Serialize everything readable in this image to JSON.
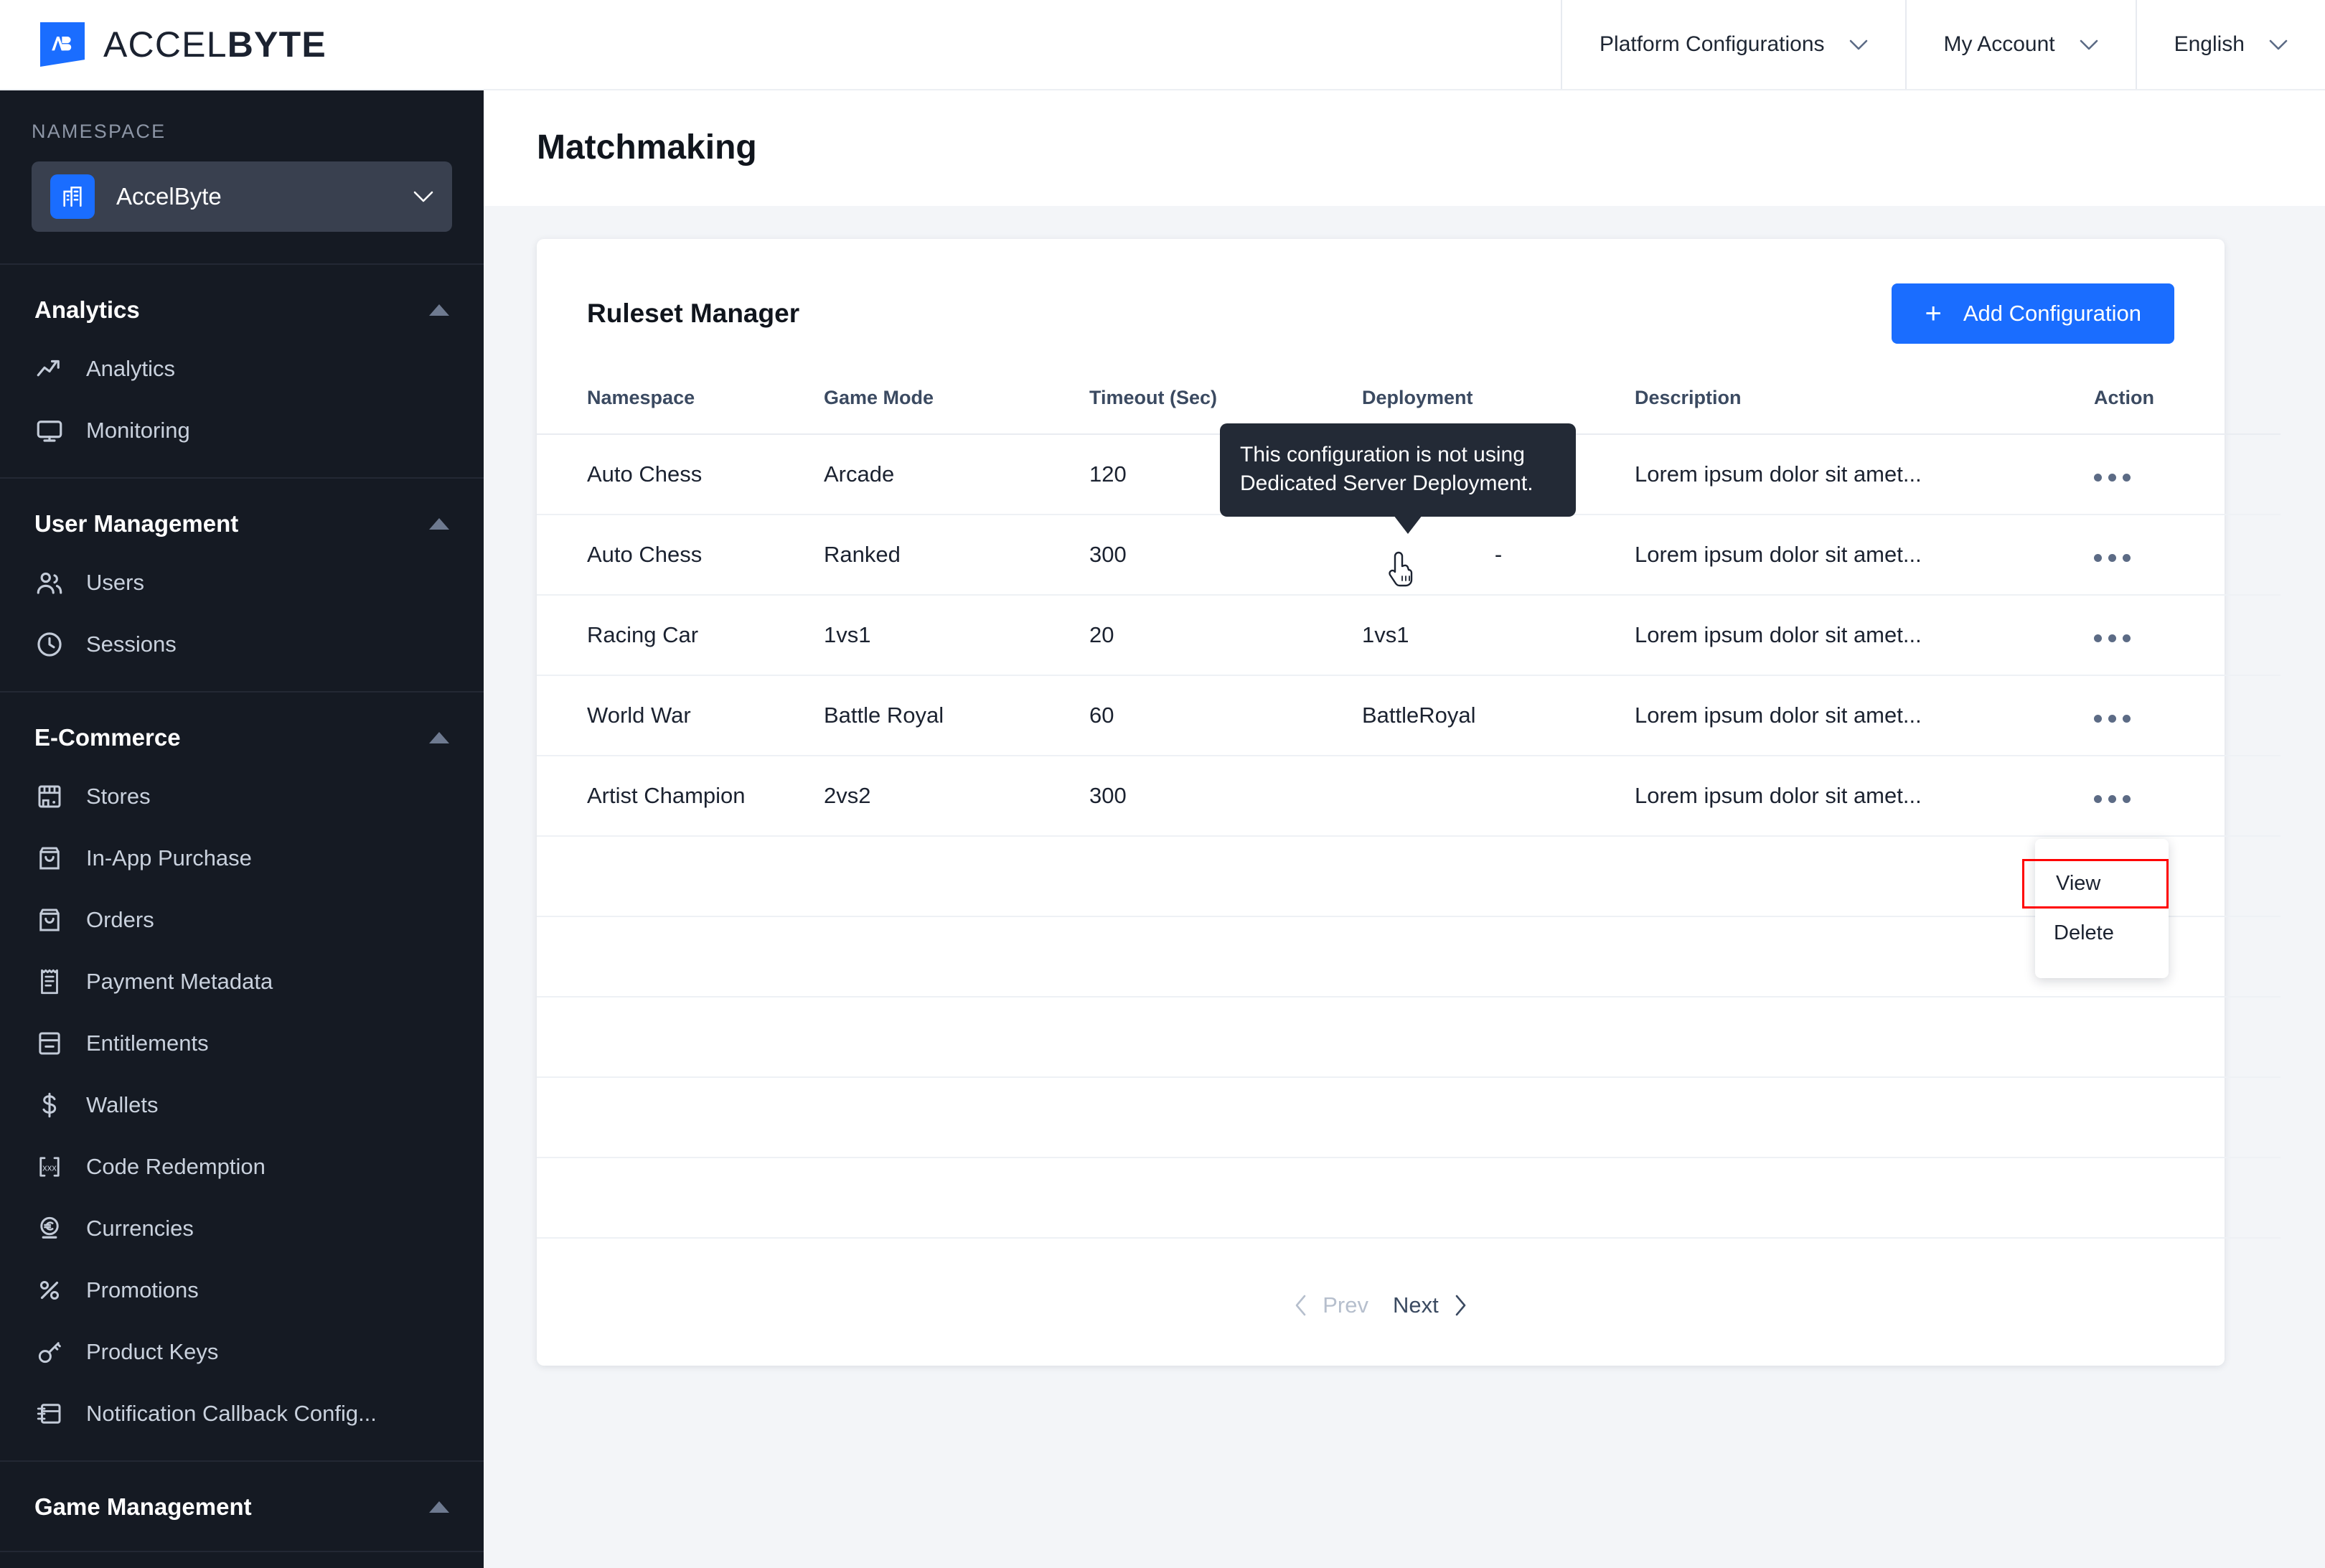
{
  "topbar": {
    "logo_text_light": "ACCEL",
    "logo_text_bold": "BYTE",
    "nav": [
      {
        "label": "Platform Configurations",
        "icon": "chevron-down-icon"
      },
      {
        "label": "My Account",
        "icon": "chevron-down-icon"
      },
      {
        "label": "English",
        "icon": "chevron-down-icon"
      }
    ]
  },
  "sidebar": {
    "namespace_label": "NAMESPACE",
    "namespace_value": "AccelByte",
    "namespace_icon": "building-icon",
    "namespace_chevron": "chevron-down-icon",
    "groups": [
      {
        "title": "Analytics",
        "caret": "caret-up-icon",
        "items": [
          {
            "label": "Analytics",
            "icon": "trending-up-icon"
          },
          {
            "label": "Monitoring",
            "icon": "monitor-icon"
          }
        ]
      },
      {
        "title": "User Management",
        "caret": "caret-up-icon",
        "items": [
          {
            "label": "Users",
            "icon": "users-icon"
          },
          {
            "label": "Sessions",
            "icon": "clock-icon"
          }
        ]
      },
      {
        "title": "E-Commerce",
        "caret": "caret-up-icon",
        "items": [
          {
            "label": "Stores",
            "icon": "store-icon"
          },
          {
            "label": "In-App Purchase",
            "icon": "shopping-bag-icon"
          },
          {
            "label": "Orders",
            "icon": "shopping-bag-icon"
          },
          {
            "label": "Payment Metadata",
            "icon": "receipt-icon"
          },
          {
            "label": "Entitlements",
            "icon": "archive-icon"
          },
          {
            "label": "Wallets",
            "icon": "dollar-icon"
          },
          {
            "label": "Code Redemption",
            "icon": "code-brackets-icon"
          },
          {
            "label": "Currencies",
            "icon": "euro-coin-icon"
          },
          {
            "label": "Promotions",
            "icon": "percent-icon"
          },
          {
            "label": "Product Keys",
            "icon": "key-icon"
          },
          {
            "label": "Notification Callback Config...",
            "icon": "callback-config-icon"
          }
        ]
      },
      {
        "title": "Game Management",
        "caret": "caret-up-icon",
        "items": []
      }
    ]
  },
  "main": {
    "page_title": "Matchmaking",
    "card_title": "Ruleset Manager",
    "add_button": {
      "label": "Add Configuration",
      "icon": "plus-icon"
    },
    "table": {
      "columns": [
        "Namespace",
        "Game Mode",
        "Timeout (Sec)",
        "Deployment",
        "Description",
        "Action"
      ],
      "rows": [
        {
          "namespace": "Auto Chess",
          "game_mode": "Arcade",
          "timeout": "120",
          "deployment": "",
          "description": "Lorem ipsum dolor sit amet...",
          "action_icon": "more-horizontal-icon"
        },
        {
          "namespace": "Auto Chess",
          "game_mode": "Ranked",
          "timeout": "300",
          "deployment": "-",
          "description": "Lorem ipsum dolor sit amet...",
          "action_icon": "more-horizontal-icon"
        },
        {
          "namespace": "Racing Car",
          "game_mode": "1vs1",
          "timeout": "20",
          "deployment": "1vs1",
          "description": "Lorem ipsum dolor sit amet...",
          "action_icon": "more-horizontal-icon"
        },
        {
          "namespace": "World War",
          "game_mode": "Battle Royal",
          "timeout": "60",
          "deployment": "BattleRoyal",
          "description": "Lorem ipsum dolor sit amet...",
          "action_icon": "more-horizontal-icon"
        },
        {
          "namespace": "Artist Champion",
          "game_mode": "2vs2",
          "timeout": "300",
          "deployment": "",
          "description": "Lorem ipsum dolor sit amet...",
          "action_icon": "more-horizontal-icon"
        }
      ],
      "empty_row_count": 5
    },
    "pagination": {
      "prev_label": "Prev",
      "next_label": "Next",
      "prev_icon": "chevron-left-icon",
      "next_icon": "chevron-right-icon",
      "prev_disabled": true
    }
  },
  "tooltip": {
    "text": "This configuration is not using Dedicated Server Deployment.",
    "cursor_icon": "pointer-hand-cursor"
  },
  "dropdown": {
    "items": [
      {
        "label": "View",
        "highlighted": true
      },
      {
        "label": "Delete",
        "highlighted": false
      }
    ]
  },
  "colors": {
    "accent_blue": "#1a6dff",
    "sidebar_bg": "#151a23",
    "namespace_bg": "#39404f",
    "page_bg": "#f3f5f8",
    "tooltip_bg": "#232a36",
    "highlight_red": "#ff0000"
  }
}
